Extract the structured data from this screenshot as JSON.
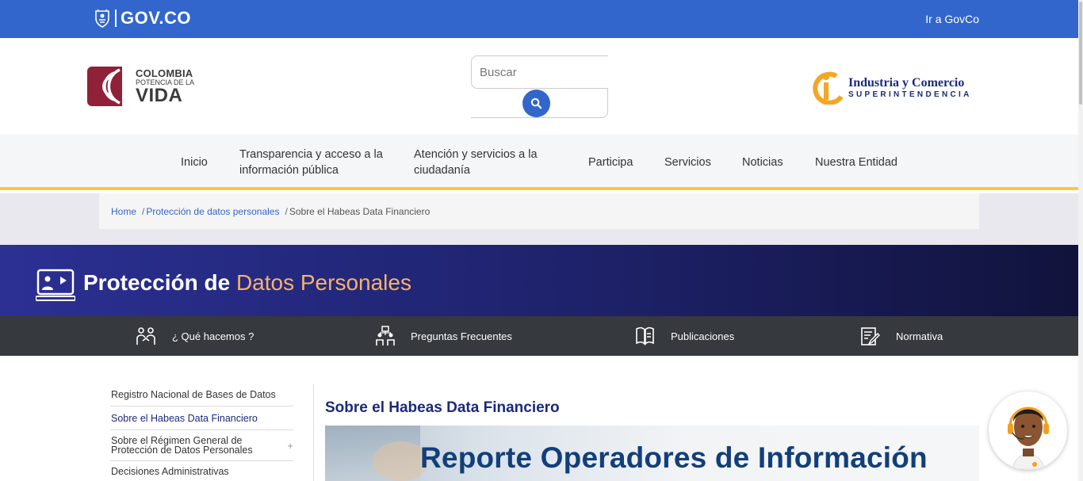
{
  "gov_bar": {
    "logo_text": "GOV.CO",
    "link_label": "Ir a GovCo"
  },
  "header": {
    "colombia_logo": {
      "line1": "COLOMBIA",
      "line2": "POTENCIA DE LA",
      "line3": "VIDA"
    },
    "search": {
      "placeholder": "Buscar",
      "button_icon": "search-icon"
    },
    "sic_logo": {
      "line1": "Industria y Comercio",
      "line2": "SUPERINTENDENCIA"
    }
  },
  "main_nav": {
    "items": [
      {
        "label": "Inicio"
      },
      {
        "label": "Transparencia y acceso a la información pública"
      },
      {
        "label": "Atención y servicios a la ciudadanía"
      },
      {
        "label": "Participa"
      },
      {
        "label": "Servicios"
      },
      {
        "label": "Noticias"
      },
      {
        "label": "Nuestra Entidad"
      }
    ]
  },
  "breadcrumb": {
    "home": "Home",
    "parent": "Protección de datos personales",
    "current": "Sobre el Habeas Data Financiero",
    "separator": "/"
  },
  "banner": {
    "title_bold": "Protección de",
    "title_accent": "Datos Personales",
    "icon": "presentation-screen-icon"
  },
  "sub_nav": {
    "items": [
      {
        "label": "¿ Qué hacemos ?",
        "icon": "people-icon"
      },
      {
        "label": "Preguntas Frecuentes",
        "icon": "team-question-icon"
      },
      {
        "label": "Publicaciones",
        "icon": "book-icon"
      },
      {
        "label": "Normativa",
        "icon": "document-edit-icon"
      }
    ]
  },
  "sidebar": {
    "items": [
      {
        "label": "Registro Nacional de Bases de Datos"
      },
      {
        "label": "Sobre el Habeas Data Financiero"
      },
      {
        "label": "Sobre el Régimen General de Protección de Datos Personales",
        "expand": "+"
      },
      {
        "label": "Decisiones Administrativas"
      }
    ]
  },
  "content": {
    "title": "Sobre el Habeas Data Financiero",
    "image_text": "Reporte Operadores de Información"
  },
  "colors": {
    "gov_blue": "#3366cc",
    "accent_yellow": "#f9c740",
    "banner_dark": "#1f236e",
    "banner_accent": "#f6b26b",
    "subnav_bg": "#36393d",
    "title_blue": "#1b2a7a"
  }
}
